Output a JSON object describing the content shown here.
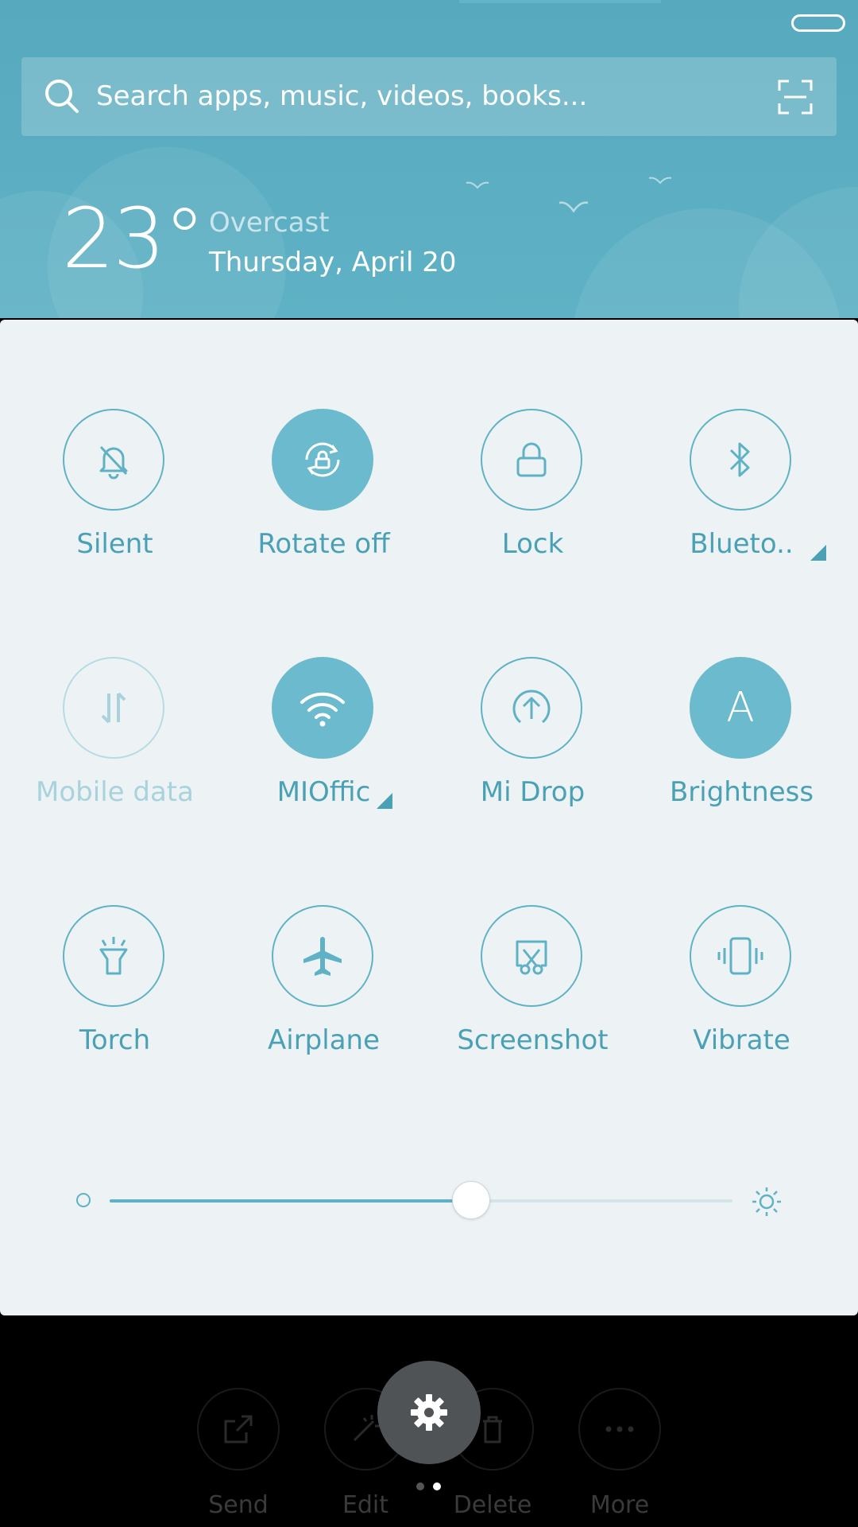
{
  "search": {
    "placeholder": "Search apps, music, videos, books..."
  },
  "weather": {
    "temperature": "23°",
    "condition": "Overcast",
    "date": "Thursday, April 20"
  },
  "tiles": [
    {
      "label": "Silent",
      "icon": "bell-off-icon",
      "state": "off"
    },
    {
      "label": "Rotate off",
      "icon": "rotate-lock-icon",
      "state": "on"
    },
    {
      "label": "Lock",
      "icon": "lock-icon",
      "state": "off"
    },
    {
      "label": "Blueto..",
      "icon": "bluetooth-icon",
      "state": "off",
      "has_menu": true
    },
    {
      "label": "Mobile data",
      "icon": "mobile-data-icon",
      "state": "disabled"
    },
    {
      "label": "MIOffic",
      "icon": "wifi-icon",
      "state": "on",
      "has_menu": true
    },
    {
      "label": "Mi Drop",
      "icon": "upload-icon",
      "state": "off"
    },
    {
      "label": "Brightness",
      "icon": "auto-brightness-icon",
      "state": "on",
      "glyph": "A"
    },
    {
      "label": "Torch",
      "icon": "torch-icon",
      "state": "off"
    },
    {
      "label": "Airplane",
      "icon": "airplane-icon",
      "state": "off"
    },
    {
      "label": "Screenshot",
      "icon": "screenshot-icon",
      "state": "off"
    },
    {
      "label": "Vibrate",
      "icon": "vibrate-icon",
      "state": "off"
    }
  ],
  "brightness": {
    "level_percent": 58
  },
  "bottom_actions": [
    {
      "label": "Send",
      "icon": "share-icon"
    },
    {
      "label": "Edit",
      "icon": "edit-icon"
    },
    {
      "label": "Delete",
      "icon": "trash-icon"
    },
    {
      "label": "More",
      "icon": "more-icon"
    }
  ],
  "page_indicator": {
    "total": 2,
    "current": 2
  },
  "colors": {
    "accent": "#5fb2c5",
    "header": "#57a9bd",
    "panel": "#edf3f5",
    "label": "#4aa0b5"
  }
}
